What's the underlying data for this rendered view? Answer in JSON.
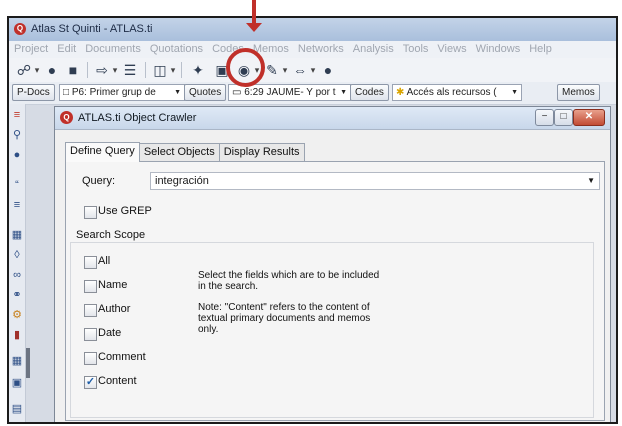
{
  "app": {
    "window_title": "Atlas St Quinti - ATLAS.ti",
    "menu": [
      "Project",
      "Edit",
      "Documents",
      "Quotations",
      "Codes",
      "Memos",
      "Networks",
      "Analysis",
      "Tools",
      "Views",
      "Windows",
      "Help"
    ]
  },
  "docbar": {
    "pdocs_label": "P-Docs",
    "pdoc_value": "P6: Primer grup de",
    "quotes_label": "Quotes",
    "quote_value": "6:29 JAUME- Y por t",
    "codes_label": "Codes",
    "code_value": "Accés als recursos (",
    "memos_label": "Memos"
  },
  "dialog": {
    "title": "ATLAS.ti Object Crawler",
    "tabs": [
      "Define Query",
      "Select Objects",
      "Display Results"
    ],
    "query_label": "Query:",
    "query_value": "integración",
    "use_grep_label": "Use GREP",
    "search_scope_label": "Search Scope",
    "scope": [
      {
        "label": "All",
        "checked": false
      },
      {
        "label": "Name",
        "checked": false
      },
      {
        "label": "Author",
        "checked": false
      },
      {
        "label": "Date",
        "checked": false
      },
      {
        "label": "Comment",
        "checked": false
      },
      {
        "label": "Content",
        "checked": true
      }
    ],
    "help_text_1": "Select the fields which are to be included in the search.",
    "help_text_2": "Note: \"Content\" refers to the content of textual primary documents and memos only."
  },
  "colors": {
    "annotation_red": "#c0302a",
    "titlebar_blue": "#a9bfdc"
  },
  "icons": {
    "annotation_arrow": "down-arrow",
    "annotation_circle": "highlight-circle",
    "check_mark": "✓"
  }
}
